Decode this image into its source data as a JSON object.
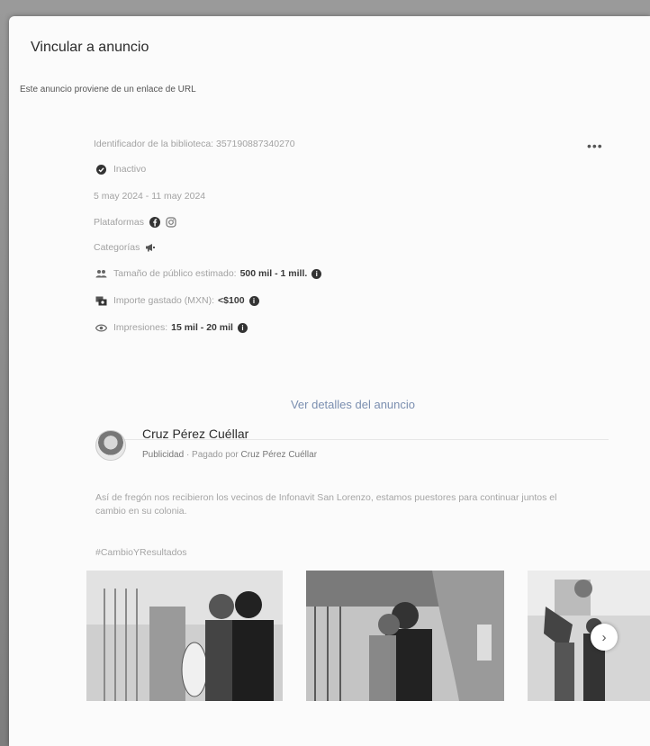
{
  "modal": {
    "title": "Vincular a anuncio",
    "subtitle": "Este anuncio proviene de un enlace de URL"
  },
  "ad": {
    "library_id": "Identificador de la biblioteca: 357190887340270",
    "status": "Inactivo",
    "dates": "5 may 2024 - 11 may 2024",
    "platforms_label": "Plataformas",
    "categories_label": "Categorías",
    "audience_label": "Tamaño de público estimado:",
    "audience_value": "500 mil - 1 mill.",
    "spend_label": "Importe gastado (MXN):",
    "spend_value": "<$100",
    "impressions_label": "Impresiones:",
    "impressions_value": "15 mil - 20 mil",
    "details_link": "Ver detalles del anuncio",
    "more_icon": "more-icon"
  },
  "post": {
    "page_name": "Cruz Pérez Cuéllar",
    "sponsored": "Publicidad",
    "paid_by": "· Pagado por",
    "payer": "Cruz Pérez Cuéllar",
    "text": "Así de fregón nos recibieron los vecinos de Infonavit San Lorenzo, estamos puestores para continuar juntos el cambio en su colonia.",
    "hashtag": "#CambioYResultados"
  },
  "colors": {
    "link": "#7b8fb0",
    "muted_text": "#a2a2a2"
  }
}
